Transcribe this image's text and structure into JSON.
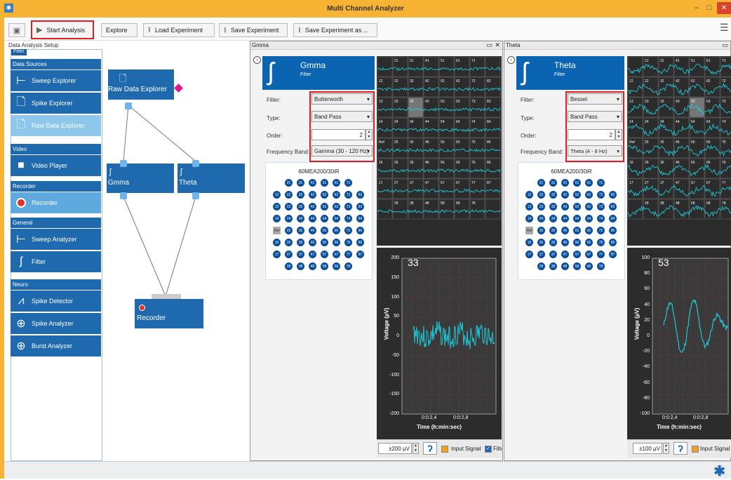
{
  "app": {
    "title": "Multi Channel Analyzer"
  },
  "window": {
    "min": "–",
    "max": "□",
    "close": "✕"
  },
  "toolbar": {
    "start": "Start Analysis",
    "explore": "Explore",
    "load": "Load Experiment",
    "save": "Save Experiment",
    "saveas": "Save Experiment as ..."
  },
  "sidebar": {
    "title": "Data Analysis Setup",
    "filter": "Filter",
    "cat1": "Data Sources",
    "cat2": "Video",
    "cat3": "Recorder",
    "cat4": "General",
    "cat5": "Neuro",
    "sweep_explorer": "Sweep Explorer",
    "spike_explorer": "Spike Explorer",
    "raw_explorer": "Raw Data Explorer",
    "video_player": "Video Player",
    "recorder": "Recorder",
    "sweep_analyzer": "Sweep Analyzer",
    "spike_detector": "Spike Detector",
    "spike_analyzer": "Spike Analyzer",
    "burst_analyzer": "Burst Analyzer"
  },
  "canvas": {
    "raw": "Raw Data Explorer",
    "gmma": "Gmma",
    "theta": "Theta",
    "recorder": "Recorder"
  },
  "panels": [
    {
      "tab": "Gmma",
      "title": "Gmma",
      "subtitle": "Filter",
      "filter_label": "Filter:",
      "filter": "Butterworth",
      "type_label": "Type:",
      "type": "Band Pass",
      "order_label": "Order:",
      "order": "2",
      "band_label": "Frequency Band:",
      "band": "Gamma (30 - 120 Hz)",
      "layout": "60MEA200/30iR",
      "channel": "33",
      "yticks": [
        "200",
        "150",
        "100",
        "50",
        "0",
        "-50",
        "-100",
        "-150",
        "-200"
      ],
      "ylabel": "Voltage (µV)",
      "xticks": [
        "0:0:2,4",
        "0:0:2,8"
      ],
      "xlabel": "Time (h:min:sec)",
      "range": "±200 µV",
      "input": "Input Signal",
      "filt": "Filte"
    },
    {
      "tab": "Theta",
      "title": "Theta",
      "subtitle": "Filter",
      "filter_label": "Filter:",
      "filter": "Bessel",
      "type_label": "Type:",
      "type": "Band Pass",
      "order_label": "Order:",
      "order": "2",
      "band_label": "Frequency Band:",
      "band": "Theta (4 - 8 Hz)",
      "layout": "60MEA200/30iR",
      "channel": "53",
      "yticks": [
        "100",
        "80",
        "60",
        "40",
        "20",
        "0",
        "-20",
        "-40",
        "-60",
        "-80",
        "-100"
      ],
      "ylabel": "Voltage (µV)",
      "xticks": [
        "0:0:2,4",
        "0:0:2,8"
      ],
      "xlabel": "Time (h:min:sec)",
      "range": "±100 µV",
      "input": "Input Signal"
    }
  ],
  "mea": {
    "rows": [
      [
        "21",
        "31",
        "41",
        "51",
        "61",
        "71"
      ],
      [
        "12",
        "22",
        "32",
        "42",
        "52",
        "62",
        "72",
        "82"
      ],
      [
        "13",
        "23",
        "33",
        "43",
        "53",
        "63",
        "73",
        "83"
      ],
      [
        "14",
        "24",
        "34",
        "44",
        "54",
        "64",
        "74",
        "84"
      ],
      [
        "Ref",
        "25",
        "35",
        "45",
        "55",
        "65",
        "75",
        "85"
      ],
      [
        "16",
        "26",
        "36",
        "46",
        "56",
        "66",
        "76",
        "86"
      ],
      [
        "17",
        "27",
        "37",
        "47",
        "57",
        "67",
        "77",
        "87"
      ],
      [
        "28",
        "38",
        "48",
        "58",
        "68",
        "78"
      ]
    ]
  },
  "colors": {
    "accent": "#1f6aaf",
    "trace": "#1ec8d8",
    "title": "#f7b334",
    "highlight": "#e02020"
  }
}
